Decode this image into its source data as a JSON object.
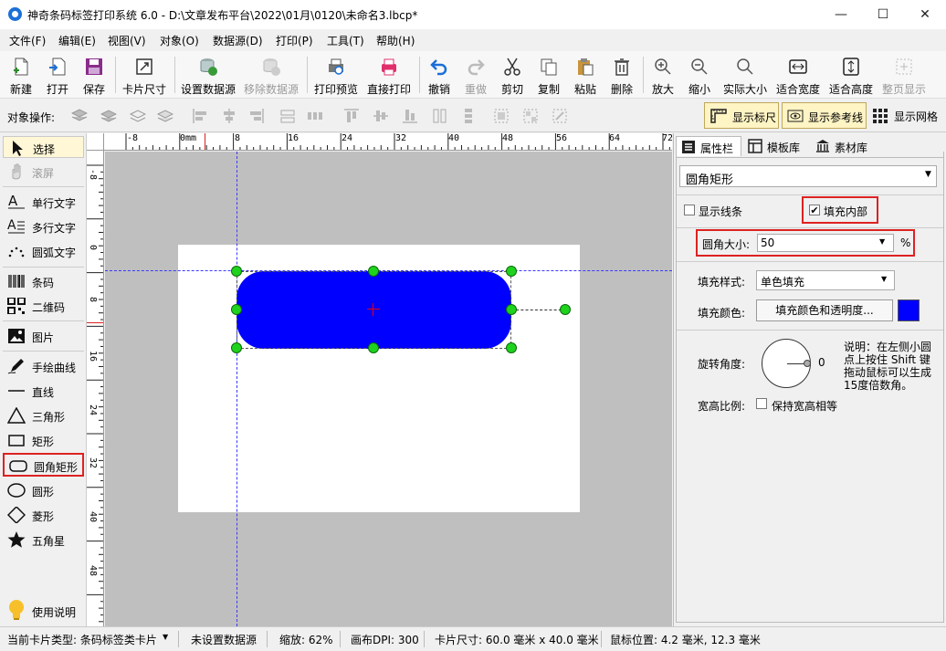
{
  "window": {
    "title": "神奇条码标签打印系统 6.0 - D:\\文章发布平台\\2022\\01月\\0120\\未命名3.lbcp*",
    "minimize": "—",
    "maximize": "☐",
    "close": "✕"
  },
  "menu": [
    "文件(F)",
    "编辑(E)",
    "视图(V)",
    "对象(O)",
    "数据源(D)",
    "打印(P)",
    "工具(T)",
    "帮助(H)"
  ],
  "toolbar": {
    "new": "新建",
    "open": "打开",
    "save": "保存",
    "card_size": "卡片尺寸",
    "set_datasource": "设置数据源",
    "remove_datasource": "移除数据源",
    "print_preview": "打印预览",
    "direct_print": "直接打印",
    "undo": "撤销",
    "redo": "重做",
    "cut": "剪切",
    "copy": "复制",
    "paste": "粘贴",
    "delete": "删除",
    "zoom_in": "放大",
    "zoom_out": "缩小",
    "actual_size": "实际大小",
    "fit_width": "适合宽度",
    "fit_height": "适合高度",
    "full_page": "整页显示"
  },
  "object_bar": {
    "label": "对象操作:",
    "show_ruler": "显示标尺",
    "show_guides": "显示参考线",
    "show_grid": "显示网格"
  },
  "tools": {
    "select": "选择",
    "scroll": "滚屏",
    "single_text": "单行文字",
    "multi_text": "多行文字",
    "arc_text": "圆弧文字",
    "barcode": "条码",
    "qrcode": "二维码",
    "image": "图片",
    "freehand": "手绘曲线",
    "line": "直线",
    "triangle": "三角形",
    "rectangle": "矩形",
    "rounded_rect": "圆角矩形",
    "circle": "圆形",
    "diamond": "菱形",
    "star": "五角星",
    "help": "使用说明"
  },
  "ruler": {
    "h_labels": [
      "-8",
      "0mm",
      "8",
      "16",
      "24",
      "32",
      "40",
      "48",
      "56",
      "64",
      "72"
    ],
    "v_labels": [
      "-8",
      "0",
      "8",
      "16",
      "24",
      "32",
      "40",
      "48"
    ]
  },
  "panel": {
    "tabs": [
      "属性栏",
      "模板库",
      "素材库"
    ],
    "object_type": "圆角矩形",
    "show_lines_label": "显示线条",
    "show_lines_checked": false,
    "fill_inside_label": "填充内部",
    "fill_inside_checked": true,
    "corner_size_label": "圆角大小:",
    "corner_size_value": "50",
    "corner_unit": "%",
    "fill_style_label": "填充样式:",
    "fill_style_value": "单色填充",
    "fill_color_label": "填充颜色:",
    "fill_color_button": "填充颜色和透明度...",
    "fill_color": "#0000ff",
    "rotation_label": "旋转角度:",
    "rotation_value": "0",
    "rotation_hint": "说明：在左侧小圆点上按住 Shift 键拖动鼠标可以生成15度倍数角。",
    "aspect_label": "宽高比例:",
    "keep_aspect_label": "保持宽高相等",
    "keep_aspect_checked": false
  },
  "status": {
    "card_type": "当前卡片类型: 条码标签类卡片",
    "datasource": "未设置数据源",
    "zoom": "缩放: 62%",
    "dpi": "画布DPI: 300",
    "card_size": "卡片尺寸: 60.0 毫米 x 40.0 毫米",
    "mouse_pos": "鼠标位置: 4.2 毫米, 12.3 毫米"
  }
}
